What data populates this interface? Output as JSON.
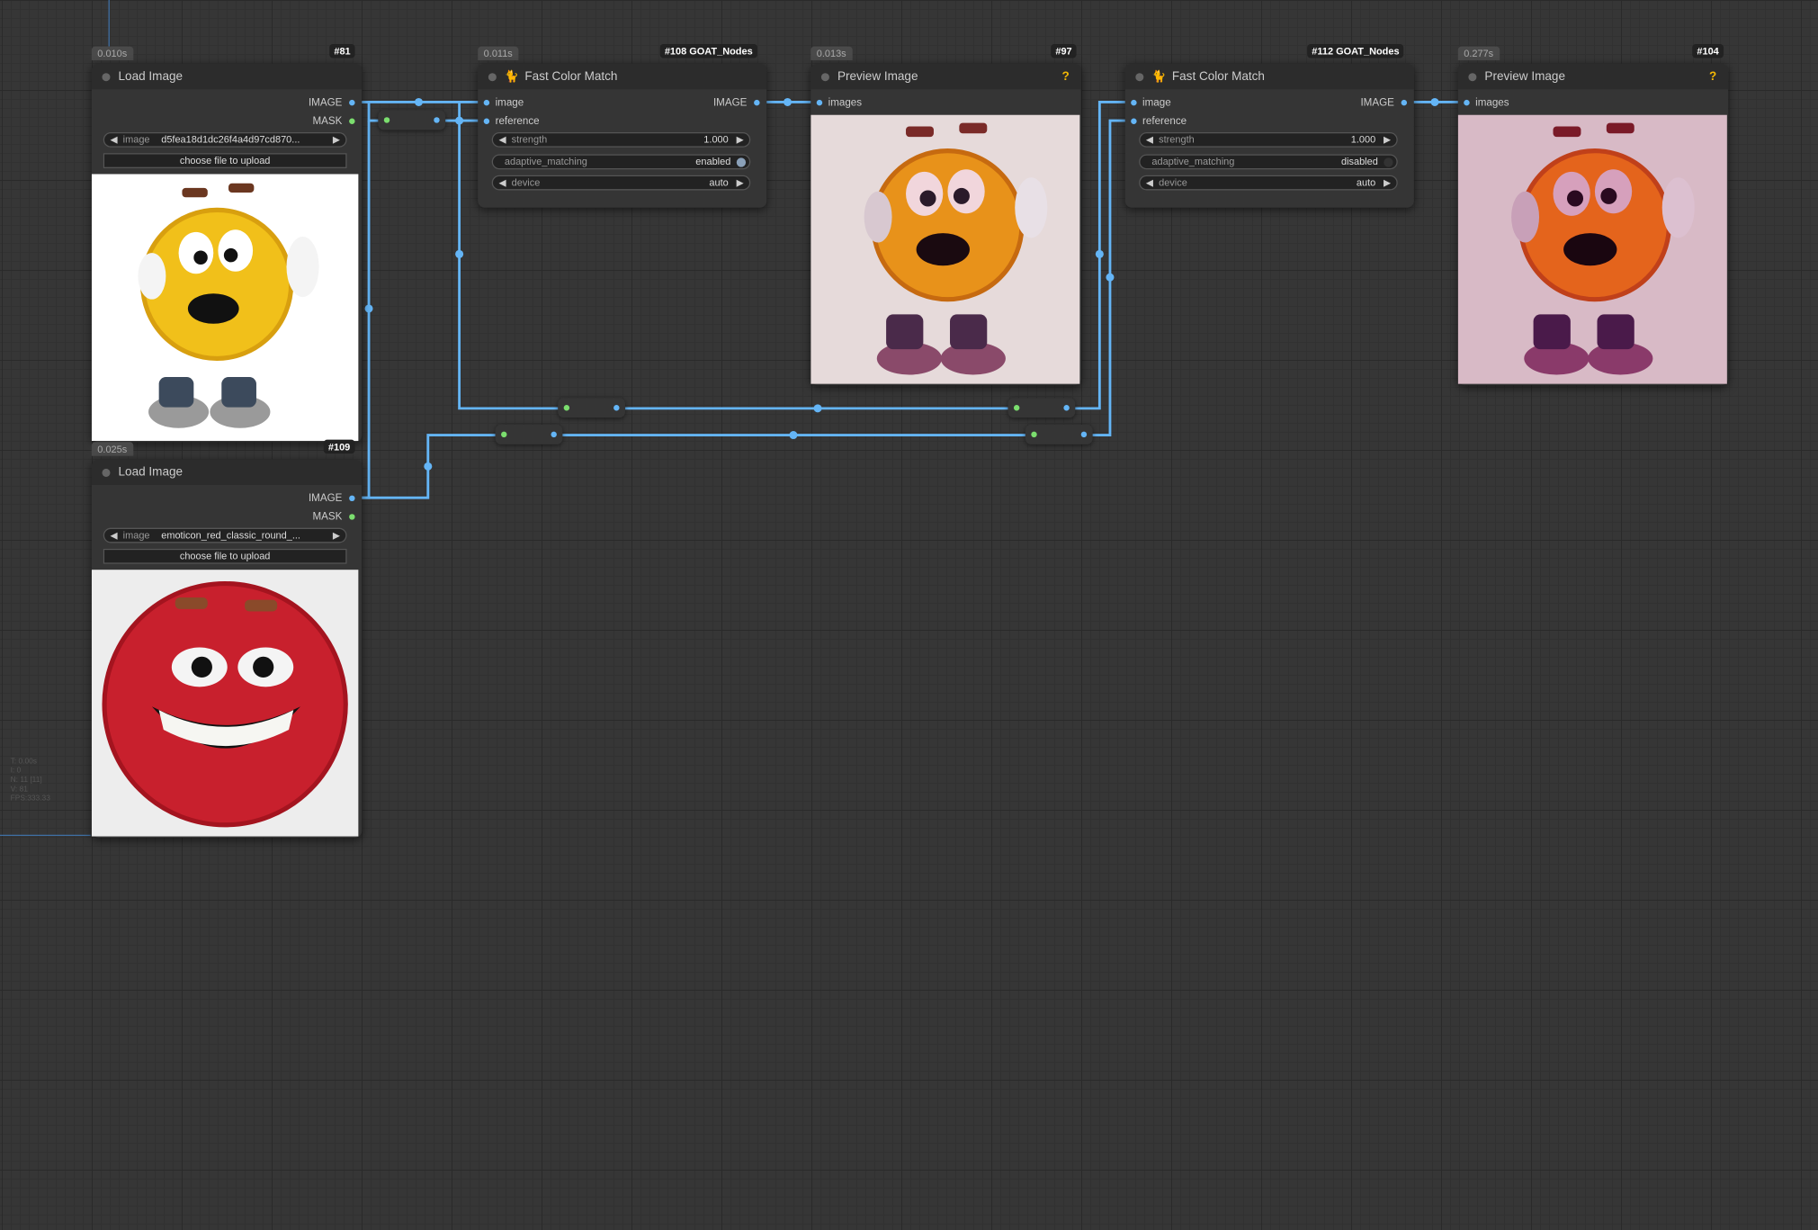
{
  "nodes": {
    "n81": {
      "time": "0.010s",
      "id": "#81",
      "title": "Load Image",
      "out1": "IMAGE",
      "out2": "MASK",
      "widget_label": "image",
      "widget_value": "d5fea18d1dc26f4a4d97cd870...",
      "upload": "choose file to upload"
    },
    "n109": {
      "time": "0.025s",
      "id": "#109",
      "title": "Load Image",
      "out1": "IMAGE",
      "out2": "MASK",
      "widget_label": "image",
      "widget_value": "emoticon_red_classic_round_...",
      "upload": "choose file to upload"
    },
    "n108": {
      "time": "0.011s",
      "id": "#108 GOAT_Nodes",
      "title": "Fast Color Match",
      "in1": "image",
      "in2": "reference",
      "out1": "IMAGE",
      "strength_label": "strength",
      "strength_value": "1.000",
      "adaptive_label": "adaptive_matching",
      "adaptive_value": "enabled",
      "device_label": "device",
      "device_value": "auto"
    },
    "n112": {
      "time": "",
      "id": "#112 GOAT_Nodes",
      "title": "Fast Color Match",
      "in1": "image",
      "in2": "reference",
      "out1": "IMAGE",
      "strength_label": "strength",
      "strength_value": "1.000",
      "adaptive_label": "adaptive_matching",
      "adaptive_value": "disabled",
      "device_label": "device",
      "device_value": "auto"
    },
    "n97": {
      "time": "0.013s",
      "id": "#97",
      "title": "Preview Image",
      "in1": "images",
      "help": "?"
    },
    "n104": {
      "time": "0.277s",
      "id": "#104",
      "title": "Preview Image",
      "in1": "images",
      "help": "?"
    }
  },
  "stats": {
    "t": "T: 0.00s",
    "i": "I: 0",
    "n": "N: 11 [11]",
    "v": "V: 81",
    "fps": "FPS:333.33"
  },
  "colors": {
    "wire": "#64b5f6",
    "slot_image": "#64b5f6",
    "slot_mask": "#7bde6e",
    "badge": "#222222"
  },
  "icons": {
    "node_emoji": "cat-icon"
  }
}
